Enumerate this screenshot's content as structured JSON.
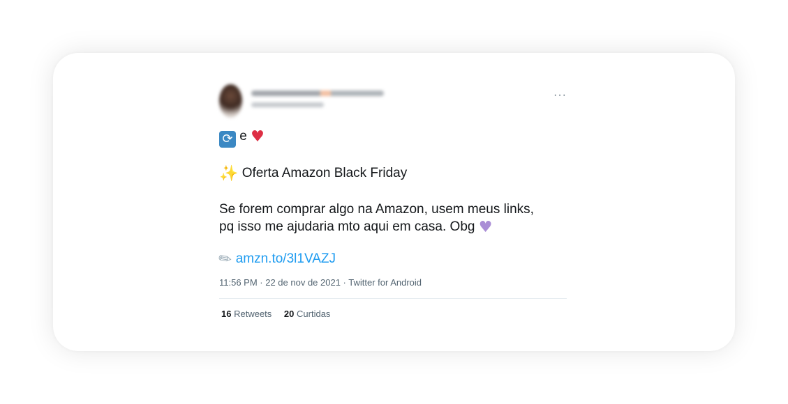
{
  "tweet": {
    "more_label": "···",
    "reaction_line": {
      "retweet_emoji": "🔃",
      "connector": "e",
      "heart_emoji": "♥"
    },
    "headline": {
      "sparkle_emoji": "✨",
      "text": "Oferta Amazon Black Friday"
    },
    "body_line1": "Se forem comprar algo na Amazon, usem meus links,",
    "body_line2": "pq isso me ajudaria mto aqui em casa. Obg",
    "purple_heart_emoji": "♥",
    "link": {
      "clip_emoji": "📎",
      "text": "amzn.to/3l1VAZJ"
    },
    "meta": "11:56 PM · 22 de nov de 2021 · Twitter for Android",
    "stats": {
      "retweets_count": "16",
      "retweets_label": "Retweets",
      "likes_count": "20",
      "likes_label": "Curtidas"
    }
  },
  "colors": {
    "link": "#1d9bf0",
    "heart": "#dd2e44",
    "purple_heart": "#aa8ed6",
    "retweet_emoji_bg": "#3b88c3"
  }
}
